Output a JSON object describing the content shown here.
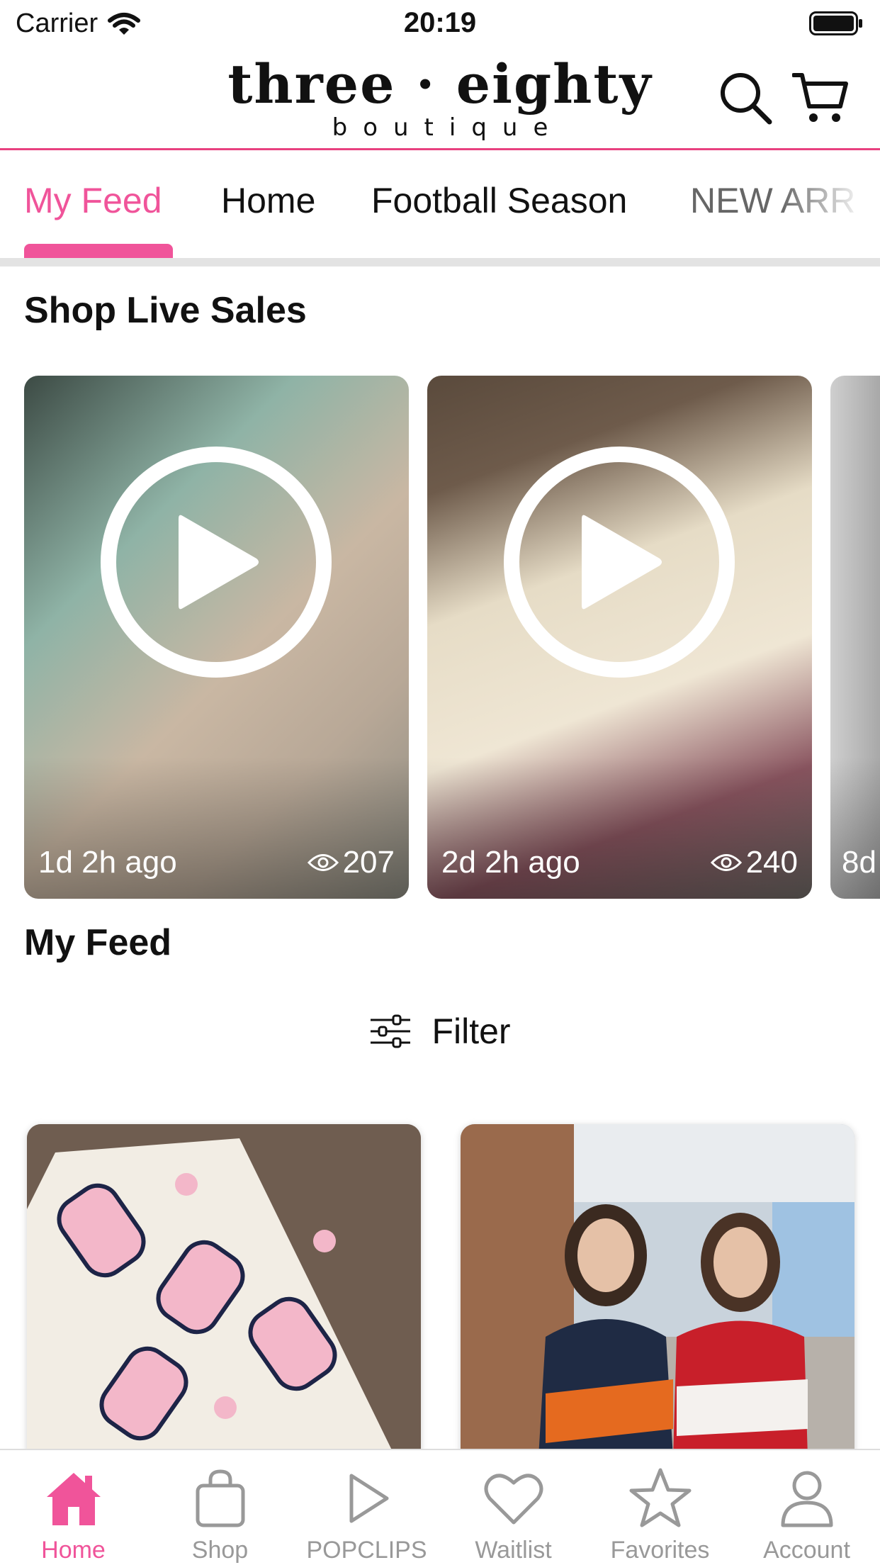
{
  "status_bar": {
    "carrier": "Carrier",
    "time": "20:19"
  },
  "header": {
    "logo_main": "three · eighty",
    "logo_sub": "boutique"
  },
  "tabs": [
    {
      "label": "My Feed",
      "active": true
    },
    {
      "label": "Home",
      "active": false
    },
    {
      "label": "Football Season",
      "active": false
    },
    {
      "label": "NEW ARR",
      "active": false
    }
  ],
  "live_sales": {
    "title": "Shop Live Sales",
    "items": [
      {
        "ago": "1d 2h ago",
        "views": "207"
      },
      {
        "ago": "2d 2h ago",
        "views": "240"
      },
      {
        "ago": "8d"
      }
    ]
  },
  "feed": {
    "title": "My Feed",
    "filter_label": "Filter"
  },
  "bottom_nav": [
    {
      "label": "Home",
      "icon": "home-icon",
      "active": true
    },
    {
      "label": "Shop",
      "icon": "bag-icon",
      "active": false
    },
    {
      "label": "POPCLIPS",
      "icon": "play-icon",
      "active": false
    },
    {
      "label": "Waitlist",
      "icon": "heart-icon",
      "active": false
    },
    {
      "label": "Favorites",
      "icon": "star-icon",
      "active": false
    },
    {
      "label": "Account",
      "icon": "person-icon",
      "active": false
    }
  ],
  "colors": {
    "accent": "#f0549a",
    "header_rule": "#e8417f",
    "inactive": "#999999"
  }
}
